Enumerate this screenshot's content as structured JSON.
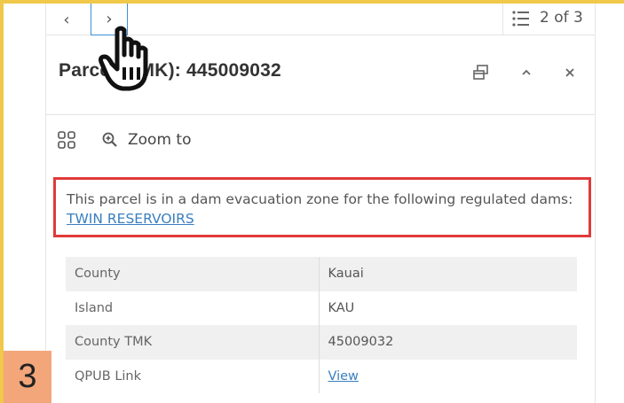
{
  "navigation": {
    "prev_glyph": "‹",
    "next_glyph": "›",
    "page_count": "2 of 3"
  },
  "feature": {
    "title": "Parcel (TMK): 445009032"
  },
  "actions": {
    "zoom_label": "Zoom to"
  },
  "alert": {
    "message": "This parcel is in a dam evacuation zone for the following regulated dams: ",
    "link_text": "TWIN RESERVOIRS",
    "border_color": "#e03a3a"
  },
  "attributes": [
    {
      "key": "County",
      "value": "Kauai"
    },
    {
      "key": "Island",
      "value": "KAU"
    },
    {
      "key": "County TMK",
      "value": "45009032"
    },
    {
      "key": "QPUB Link",
      "value": "View"
    }
  ],
  "step_badge": "3",
  "icons": {
    "prev": "chevron-left-icon",
    "next": "chevron-right-icon",
    "list": "list-icon",
    "float": "dock-float-icon",
    "collapse": "chevron-up-icon",
    "close": "close-icon",
    "grid": "grid-icon",
    "zoom": "zoom-in-icon",
    "cursor": "hand-pointer-icon"
  },
  "colors": {
    "frame": "#f0c84a",
    "accent": "#3c8fd6",
    "link": "#3a7fc0",
    "badge": "#f2a67a"
  }
}
